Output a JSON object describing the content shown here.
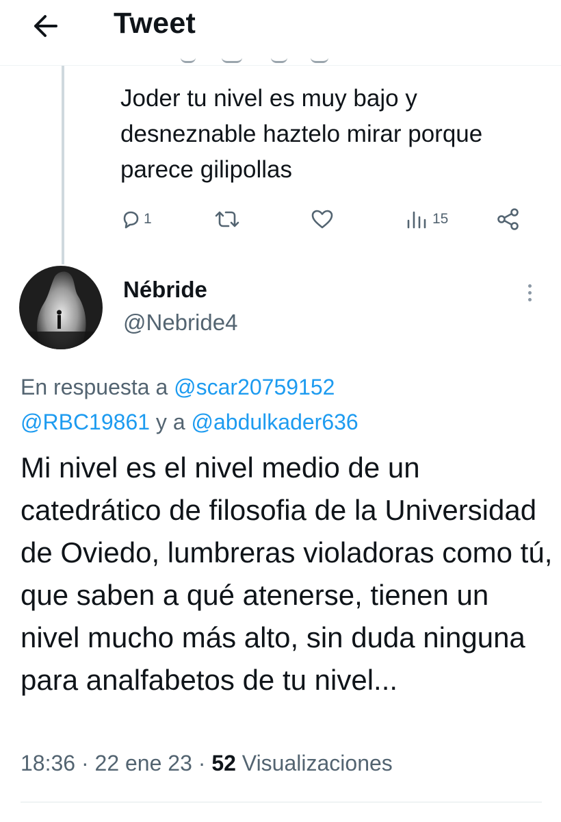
{
  "header": {
    "title": "Tweet",
    "back_icon": "arrow-left-icon"
  },
  "previous_tweet": {
    "text": "Joder tu nivel es muy bajo y desneznable haztelo mirar porque parece gilipollas",
    "actions": {
      "reply_count": "1",
      "retweet_count": "",
      "like_count": "",
      "views_count": "15"
    }
  },
  "main_tweet": {
    "display_name": "Nébride",
    "handle": "@Nebride4",
    "reply_prefix": "En respuesta a ",
    "mention_1": "@scar20759152",
    "mention_2": "@RBC19861",
    "reply_connector": " y a ",
    "mention_3": "@abdulkader636",
    "text": "Mi nivel es el nivel medio de un catedrático de filosofia de la Universidad de Oviedo, lumbreras violadoras como tú, que saben a qué atenerse, tienen un nivel mucho más alto, sin duda ninguna para analfabetos de tu nivel...",
    "time": "18:36",
    "date": "22 ene 23",
    "separator": " · ",
    "views_count": "52",
    "views_label": "Visualizaciones"
  },
  "colors": {
    "accent": "#1d9bf0",
    "text_primary": "#0f1419",
    "text_secondary": "#536471",
    "divider": "#eff3f4"
  }
}
